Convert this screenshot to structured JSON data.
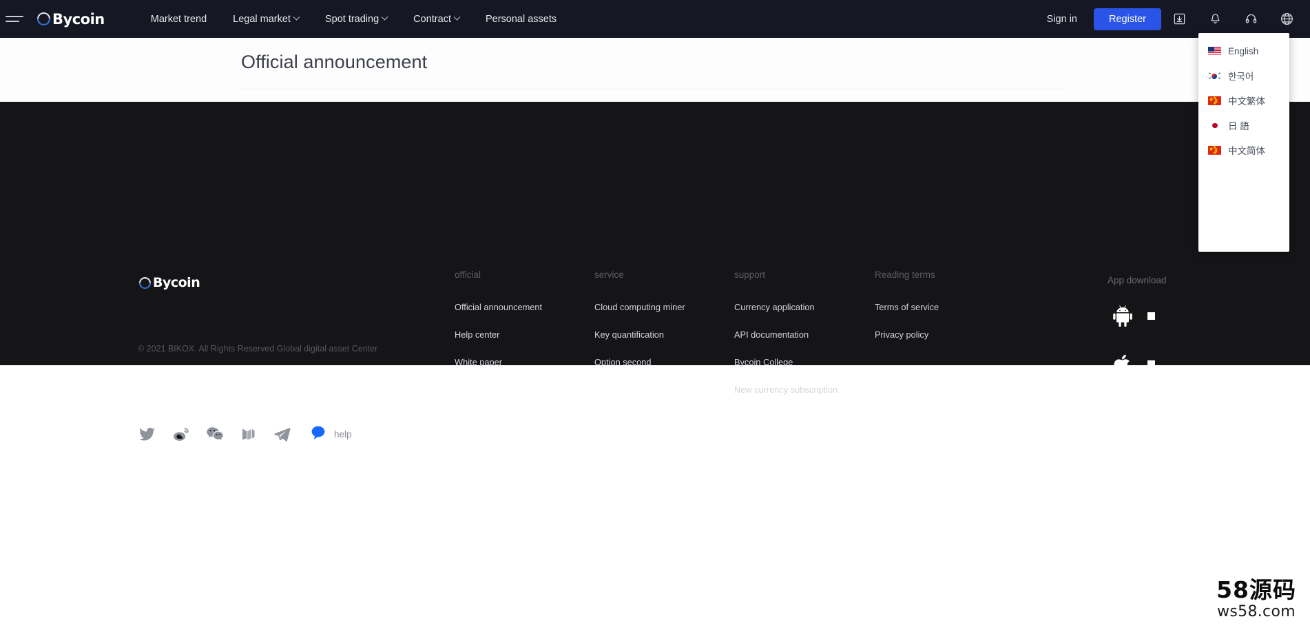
{
  "header": {
    "menu_icon": "hamburger-icon",
    "brand": "Bycoin",
    "nav": [
      {
        "label": "Market trend",
        "has_caret": false
      },
      {
        "label": "Legal market",
        "has_caret": true
      },
      {
        "label": "Spot trading",
        "has_caret": true
      },
      {
        "label": "Contract",
        "has_caret": true
      },
      {
        "label": "Personal assets",
        "has_caret": false
      }
    ],
    "sign_in": "Sign in",
    "register": "Register",
    "icons": [
      "download-icon",
      "bell-icon",
      "headset-icon",
      "globe-icon"
    ],
    "accent_color": "#2A54E8",
    "background_color": "#151823"
  },
  "language_menu": {
    "items": [
      {
        "label": "English",
        "flag": "flag-us"
      },
      {
        "label": "한국어",
        "flag": "flag-kr"
      },
      {
        "label": "中文繁体",
        "flag": "flag-cn"
      },
      {
        "label": "日 語",
        "flag": "flag-jp"
      },
      {
        "label": "中文简体",
        "flag": "flag-cn"
      }
    ]
  },
  "main": {
    "page_title": "Official announcement"
  },
  "footer": {
    "brand": "Bycoin",
    "copyright": "© 2021 BIKOX. All Rights Reserved Global digital asset Center",
    "background_color": "#151417",
    "columns": [
      {
        "heading": "official",
        "links": [
          "Official announcement",
          "Help center",
          "White paper"
        ]
      },
      {
        "heading": "service",
        "links": [
          "Cloud computing miner",
          "Key quantification",
          "Option second"
        ]
      },
      {
        "heading": "support",
        "links": [
          "Currency application",
          "API documentation",
          "Bycoin College",
          "New currency subscription"
        ]
      },
      {
        "heading": "Reading terms",
        "links": [
          "Terms of service",
          "Privacy policy"
        ]
      }
    ],
    "app_download": {
      "title": "App download",
      "platforms": [
        "android-icon",
        "apple-icon"
      ]
    },
    "social_icons": [
      "twitter-icon",
      "weibo-icon",
      "wechat-icon",
      "medium-icon",
      "telegram-icon"
    ],
    "help_label": "help"
  },
  "watermark": {
    "line1": "58源码",
    "line2": "ws58.com"
  }
}
